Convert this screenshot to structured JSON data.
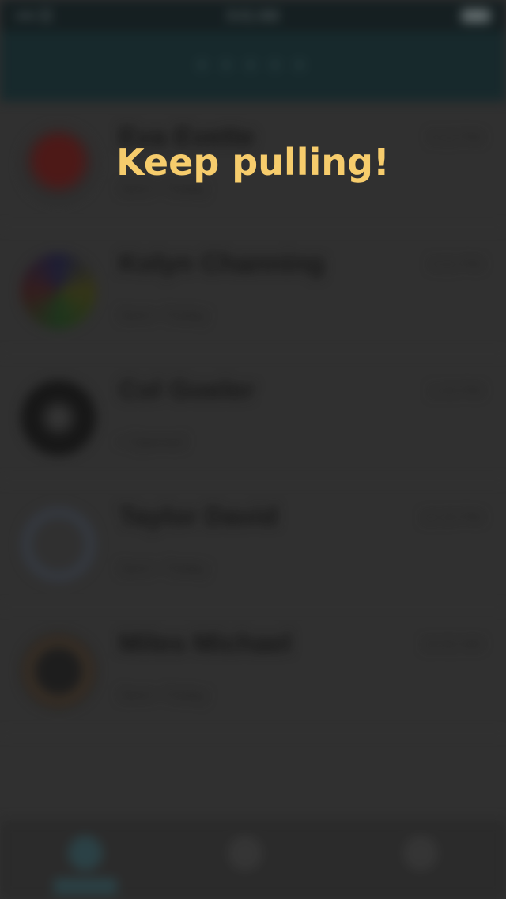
{
  "status_bar": {
    "carrier": "•••• ☰",
    "time": "9:41 AM",
    "battery_icon": "battery-icon"
  },
  "nav": {
    "title": "• • • • •"
  },
  "contacts": [
    {
      "name": "Eva Evette",
      "status": "Sent • Today",
      "time": "5:12 PM"
    },
    {
      "name": "Kolyn Channing",
      "status": "Sent • Today",
      "time": "3:21 PM"
    },
    {
      "name": "Col Goeler",
      "status": "• Opened",
      "time": "1:43 PM"
    },
    {
      "name": "Taylor David",
      "status": "Sent • Today",
      "time": "12:15 PM"
    },
    {
      "name": "Miles Michael",
      "status": "Sent • Today",
      "time": "10:02 AM"
    }
  ],
  "toast": {
    "message": "Keep pulling!"
  },
  "colors": {
    "toast": "#f6cc6c",
    "nav": "#122a2e",
    "background": "#333333"
  }
}
